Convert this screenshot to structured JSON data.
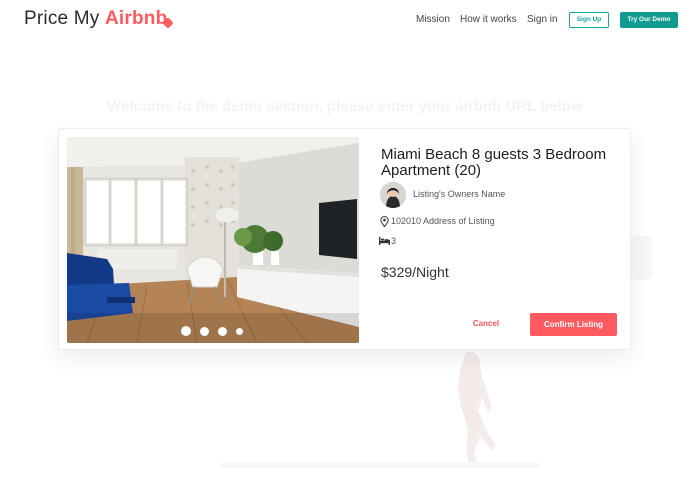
{
  "brand": {
    "part1": "Price My ",
    "part2": "Airbnb"
  },
  "nav": {
    "links": [
      "Mission",
      "How it works",
      "Sign in"
    ],
    "signup_label": "Sign Up",
    "demo_label": "Try Our Demo"
  },
  "welcome_text": "Welcome to the demo section, please enter your airbnb URL below",
  "listing": {
    "title": "Miami Beach 8 guests 3 Bedroom Apartment (20)",
    "owner_name": "Listing's Owners Name",
    "address": "102010 Address of Listing",
    "beds": "3",
    "price": "$329/Night",
    "carousel": {
      "total": 4,
      "active": 1
    }
  },
  "actions": {
    "cancel_label": "Cancel",
    "confirm_label": "Confirm Listing"
  },
  "colors": {
    "brand": "#ff5a5f",
    "teal": "#119c92",
    "teal_outline": "#1aa7a0"
  },
  "icons": {
    "location": "pin-icon",
    "beds": "bed-icon",
    "logo": "tag-icon"
  }
}
